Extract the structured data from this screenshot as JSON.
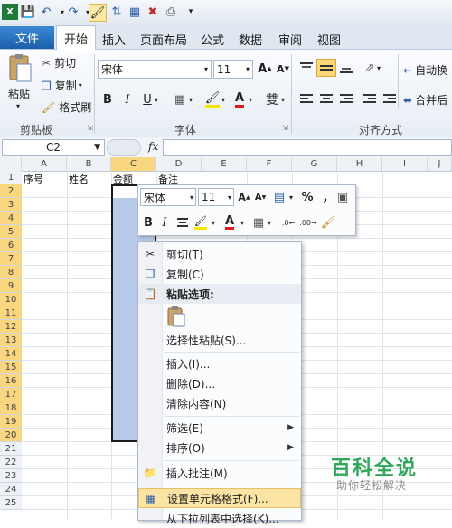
{
  "qat": {
    "icons": [
      "excel-icon",
      "save-icon",
      "undo-icon",
      "redo-icon",
      "format-painter-icon",
      "sort-icon",
      "table-icon",
      "remove-icon",
      "print-icon",
      "customize-icon"
    ]
  },
  "tabs": {
    "file": "文件",
    "items": [
      "开始",
      "插入",
      "页面布局",
      "公式",
      "数据",
      "审阅",
      "视图"
    ]
  },
  "clipboard": {
    "paste": "粘贴",
    "cut": "剪切",
    "copy": "复制",
    "format_painter": "格式刷",
    "group": "剪贴板"
  },
  "font": {
    "name": "宋体",
    "size": "11",
    "group": "字体",
    "bold": "B",
    "italic": "I",
    "underline": "U",
    "wen": "雙"
  },
  "alignment": {
    "group": "对齐方式",
    "wrap": "自动换",
    "merge": "合并后"
  },
  "formula_bar": {
    "name_box": "C2",
    "fx": "fx",
    "formula": ""
  },
  "columns": [
    "A",
    "B",
    "C",
    "D",
    "E",
    "F",
    "G",
    "H",
    "I",
    "J"
  ],
  "rows": [
    "1",
    "2",
    "3",
    "4",
    "5",
    "6",
    "7",
    "8",
    "9",
    "10",
    "11",
    "12",
    "13",
    "14",
    "15",
    "16",
    "17",
    "18",
    "19",
    "20",
    "21",
    "22",
    "23",
    "24",
    "25"
  ],
  "headers": {
    "a1": "序号",
    "b1": "姓名",
    "c1": "金额",
    "d1": "备注"
  },
  "mini_toolbar": {
    "font": "宋体",
    "size": "11",
    "percent": "%",
    "comma": ",",
    "bold": "B",
    "italic": "I"
  },
  "context_menu": {
    "cut": "剪切(T)",
    "copy": "复制(C)",
    "paste_options": "粘贴选项:",
    "paste_special": "选择性粘贴(S)...",
    "insert": "插入(I)...",
    "delete": "删除(D)...",
    "clear": "清除内容(N)",
    "filter": "筛选(E)",
    "sort": "排序(O)",
    "insert_comment": "插入批注(M)",
    "format_cells": "设置单元格格式(F)...",
    "pick_list": "从下拉列表中选择(K)..."
  },
  "watermark": {
    "title": "百科全说",
    "subtitle": "助你轻松解决"
  },
  "colors": {
    "accent": "#1b5faa",
    "selection": "#b8cbe8",
    "highlight": "#fbe4a4",
    "header_sel": "#f9d67f"
  }
}
